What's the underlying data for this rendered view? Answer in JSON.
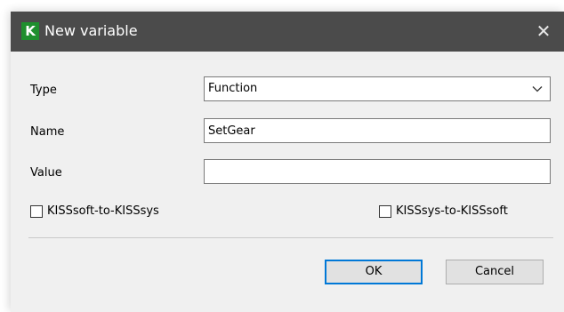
{
  "window": {
    "title": "New variable",
    "app_icon_letter": "K",
    "close_glyph": "✕"
  },
  "form": {
    "type_label": "Type",
    "type_value": "Function",
    "name_label": "Name",
    "name_value": "SetGear",
    "value_label": "Value",
    "value_value": ""
  },
  "checkboxes": {
    "kisssoft_to_kisssys": {
      "label": "KISSsoft-to-KISSsys",
      "checked": false
    },
    "kisssys_to_kisssoft": {
      "label": "KISSsys-to-KISSsoft",
      "checked": false
    }
  },
  "buttons": {
    "ok_label": "OK",
    "cancel_label": "Cancel"
  },
  "colors": {
    "titlebar": "#4b4b4b",
    "app_icon_bg": "#1f8f2e",
    "dialog_bg": "#f0f0f0",
    "default_button_border": "#0078d7"
  },
  "icons": {
    "app": "kisssoft-app-icon",
    "close": "close-icon",
    "dropdown": "chevron-down-icon"
  }
}
